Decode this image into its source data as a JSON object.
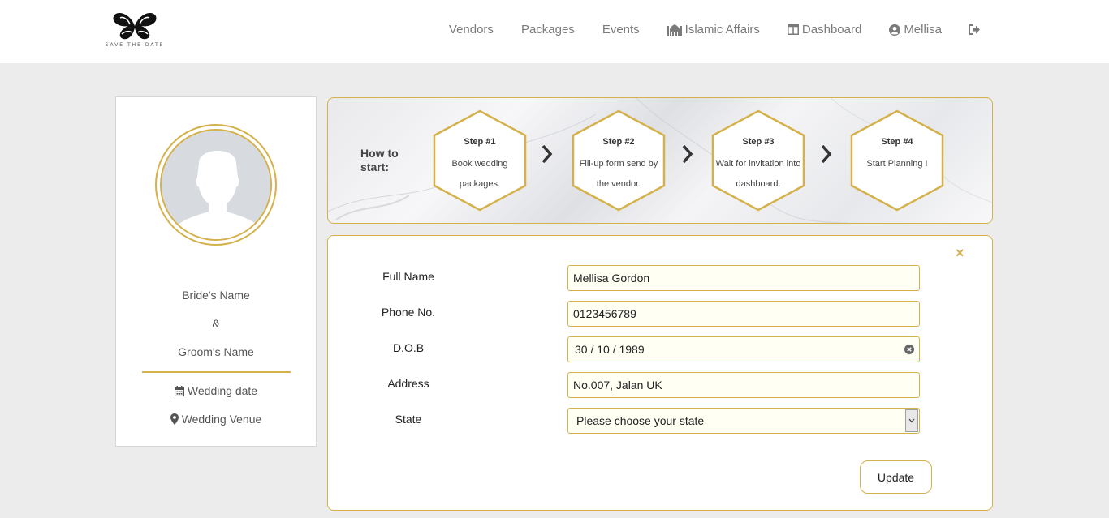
{
  "header": {
    "logo_text": "SAVE THE DATE",
    "nav": [
      {
        "label": "Vendors"
      },
      {
        "label": "Packages"
      },
      {
        "label": "Events"
      },
      {
        "label": "Islamic Affairs",
        "icon": "mosque-icon"
      },
      {
        "label": "Dashboard",
        "icon": "dashboard-icon"
      },
      {
        "label": "Mellisa",
        "icon": "user-icon"
      }
    ],
    "logout_icon": "logout-icon"
  },
  "profile": {
    "bride": "Bride's Name",
    "ampersand": "&",
    "groom": "Groom's Name",
    "wedding_date": "Wedding date",
    "wedding_venue": "Wedding Venue"
  },
  "steps": {
    "intro": "How to start:",
    "items": [
      {
        "title": "Step #1",
        "text": "Book wedding packages."
      },
      {
        "title": "Step #2",
        "text": "Fill-up form send by the vendor."
      },
      {
        "title": "Step #3",
        "text": "Wait for invitation into dashboard."
      },
      {
        "title": "Step #4",
        "text": "Start Planning !"
      }
    ]
  },
  "form": {
    "fields": [
      {
        "label": "Full Name",
        "value": "Mellisa Gordon"
      },
      {
        "label": "Phone No.",
        "value": "0123456789"
      },
      {
        "label": "D.O.B",
        "value": "30 / 10 / 1989"
      },
      {
        "label": "Address",
        "value": "No.007, Jalan UK"
      },
      {
        "label": "State",
        "value": "Please choose your state"
      }
    ],
    "update_label": "Update",
    "close_glyph": "×"
  },
  "colors": {
    "accent": "#d4b14a",
    "background": "#ececec"
  }
}
